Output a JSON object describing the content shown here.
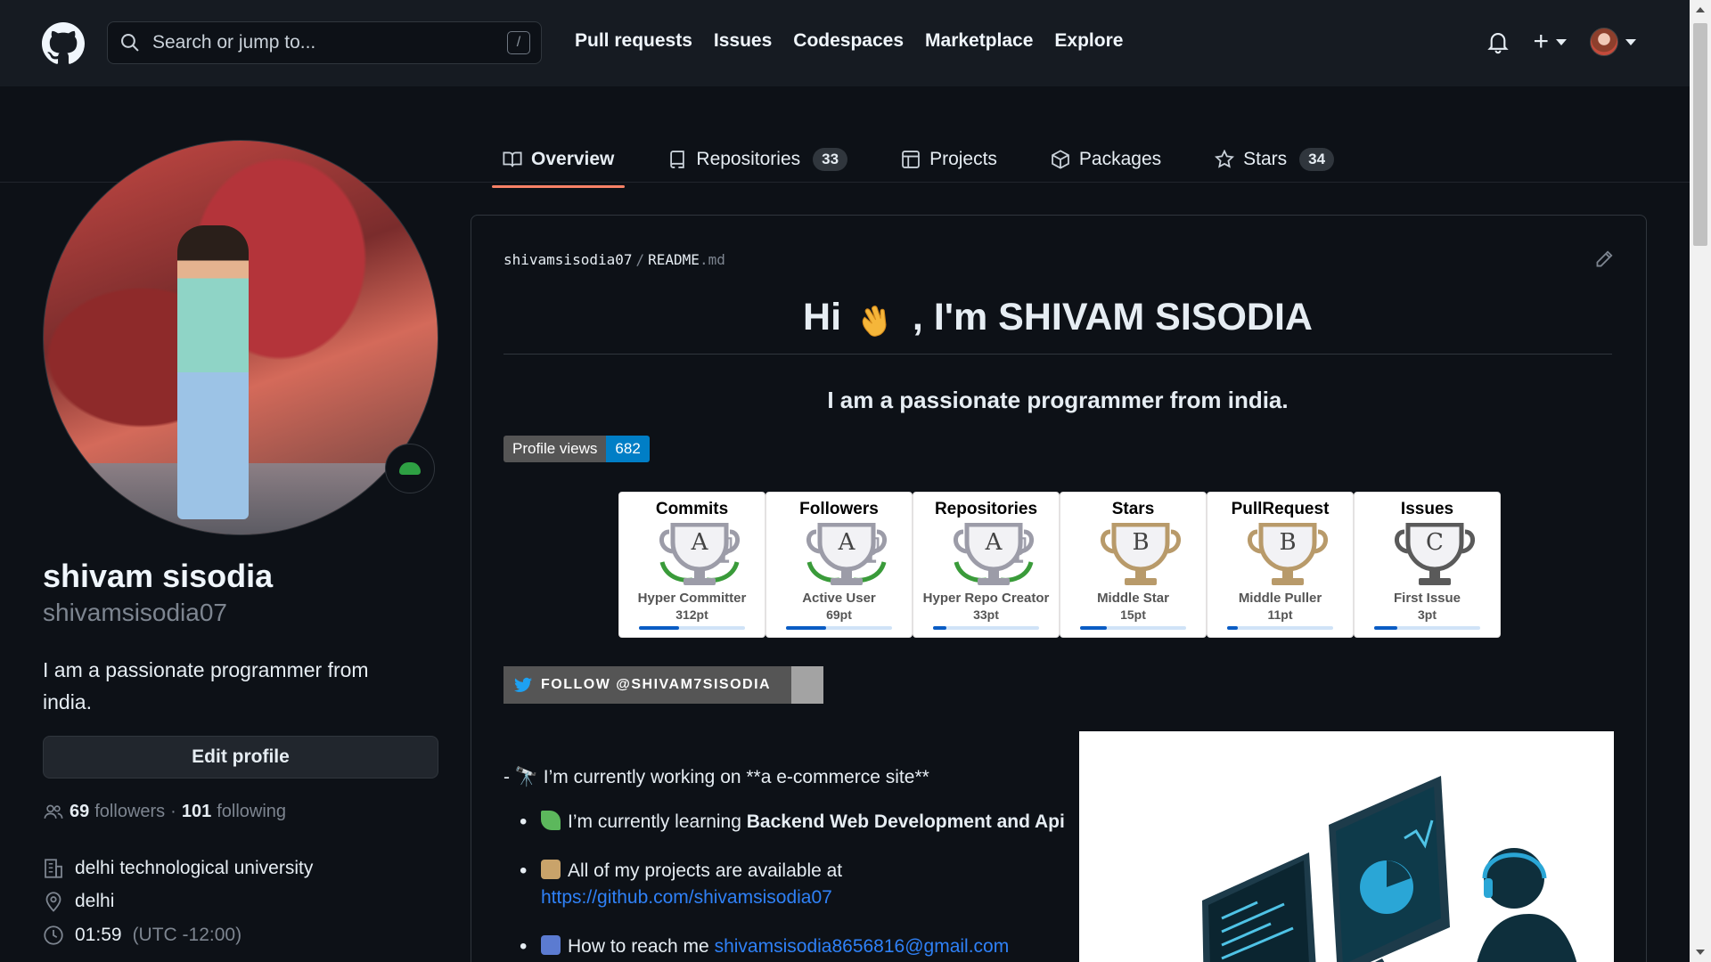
{
  "header": {
    "search_placeholder": "Search or jump to...",
    "search_shortcut": "/",
    "nav": [
      "Pull requests",
      "Issues",
      "Codespaces",
      "Marketplace",
      "Explore"
    ],
    "plus": "+"
  },
  "tabs": [
    {
      "label": "Overview",
      "icon": "book-icon",
      "active": true
    },
    {
      "label": "Repositories",
      "icon": "repo-icon",
      "count": "33"
    },
    {
      "label": "Projects",
      "icon": "table-icon"
    },
    {
      "label": "Packages",
      "icon": "package-icon"
    },
    {
      "label": "Stars",
      "icon": "star-icon",
      "count": "34"
    }
  ],
  "profile": {
    "name": "shivam sisodia",
    "login": "shivamsisodia07",
    "bio": "I am a passionate programmer from india.",
    "edit_label": "Edit profile",
    "followers_count": "69",
    "followers_label": "followers",
    "dot": "·",
    "following_count": "101",
    "following_label": "following",
    "org": "delhi technological university",
    "location": "delhi",
    "time": "01:59",
    "timezone": "(UTC -12:00)"
  },
  "readme": {
    "owner": "shivamsisodia07",
    "sep": "/",
    "file": "README",
    "ext": ".md",
    "title_pre": "Hi",
    "title_post": ", I'm SHIVAM SISODIA",
    "subtitle": "I am a passionate programmer from india.",
    "views_label": "Profile views",
    "views_count": "682",
    "twitter_label": "FOLLOW @SHIVAM7SISODIA",
    "line0": "- 🔭 I’m currently working on **a e-commerce site**",
    "learning_pre": "I’m currently learning",
    "learning_bold": "Backend Web Development and Api",
    "projects_pre": "All of my projects are available at",
    "projects_link": "https://github.com/shivamsisodia07",
    "reach_pre": "How to reach me",
    "reach_link": "shivamsisodia8656816@gmail.com"
  },
  "trophies": [
    {
      "title": "Commits",
      "grade": "A",
      "rank": "Hyper Committer",
      "points": "312pt",
      "color": "#9c9ca8",
      "progress": 0.38,
      "laurel": true
    },
    {
      "title": "Followers",
      "grade": "A",
      "rank": "Active User",
      "points": "69pt",
      "color": "#9c9ca8",
      "progress": 0.38,
      "laurel": true
    },
    {
      "title": "Repositories",
      "grade": "A",
      "rank": "Hyper Repo Creator",
      "points": "33pt",
      "color": "#9c9ca8",
      "progress": 0.13,
      "laurel": true
    },
    {
      "title": "Stars",
      "grade": "B",
      "rank": "Middle Star",
      "points": "15pt",
      "color": "#b89a6a",
      "progress": 0.25,
      "laurel": false
    },
    {
      "title": "PullRequest",
      "grade": "B",
      "rank": "Middle Puller",
      "points": "11pt",
      "color": "#b89a6a",
      "progress": 0.1,
      "laurel": false
    },
    {
      "title": "Issues",
      "grade": "C",
      "rank": "First Issue",
      "points": "3pt",
      "color": "#5a5a5a",
      "progress": 0.22,
      "laurel": false
    }
  ]
}
